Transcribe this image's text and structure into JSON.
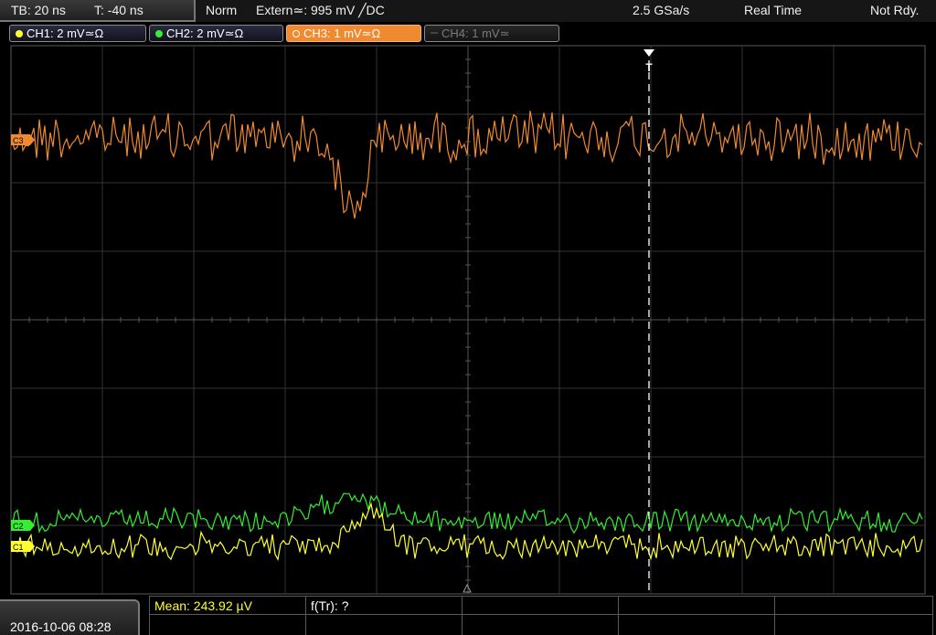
{
  "header": {
    "timebase": "TB: 20 ns",
    "time_offset": "T: -40 ns",
    "trigger_mode": "Norm",
    "trigger_source": "Extern≃: 995 mV ╱DC",
    "sample_rate": "2.5 GSa/s",
    "acquisition_mode": "Real Time",
    "status": "Not Rdy."
  },
  "channels": [
    {
      "label": "CH1: 2 mV≃Ω",
      "color": "#ffff33",
      "active": true
    },
    {
      "label": "CH2: 2 mV≃Ω",
      "color": "#33ee33",
      "active": true
    },
    {
      "label": "CH3: 1 mV≃Ω",
      "color": "#f08a30",
      "active": true
    },
    {
      "label": "CH4: 1 mV≃",
      "color": "#555555",
      "active": false
    }
  ],
  "markers": {
    "ch3": "C3",
    "ch2": "C2",
    "ch1": "C1",
    "trigger": "T"
  },
  "measurements": {
    "mean": "Mean: 243.92 µV",
    "frequency": "f(Tr): ?"
  },
  "footer": {
    "datetime": "2016-10-06 08:28"
  },
  "icons": [
    "trigger-marker-icon",
    "center-marker-icon",
    "channel-dot-icon"
  ],
  "colors": {
    "ch1": "#ffff33",
    "ch2": "#33ee33",
    "ch3": "#f08a30",
    "grid": "#3a3a3a"
  }
}
